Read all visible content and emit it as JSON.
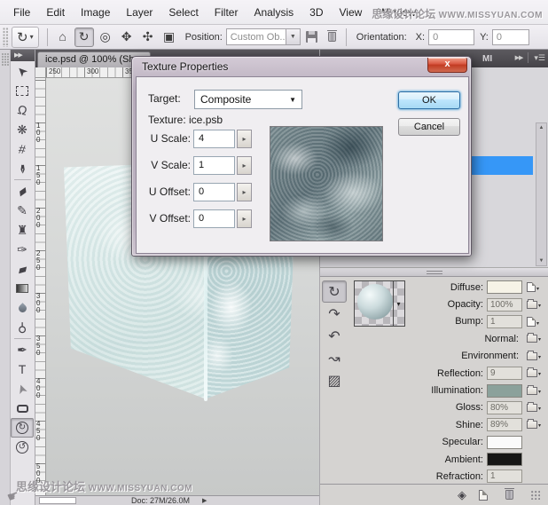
{
  "app": {
    "watermark_text": "思缘设计论坛",
    "watermark_url": "WWW.MISSYUAN.COM"
  },
  "menu_bar": {
    "items": [
      "File",
      "Edit",
      "Image",
      "Layer",
      "Select",
      "Filter",
      "Analysis",
      "3D",
      "View",
      "Window"
    ]
  },
  "options_bar": {
    "active_tool_glyph": "↻",
    "tools": [
      {
        "name": "return-to-initial-position",
        "glyph": "⌂"
      },
      {
        "name": "rotate-3d-object",
        "glyph": "↻",
        "selected": true
      },
      {
        "name": "roll-3d-object",
        "glyph": "◎"
      },
      {
        "name": "pan-3d-object",
        "glyph": "✥"
      },
      {
        "name": "slide-3d-object",
        "glyph": "✣"
      },
      {
        "name": "scale-3d-object",
        "glyph": "▣"
      }
    ],
    "position_label": "Position:",
    "position_value": "Custom Ob...",
    "orientation_label": "Orientation:",
    "x_label": "X:",
    "x_value": "0",
    "y_label": "Y:",
    "y_value": "0"
  },
  "toolbar": {
    "collapse_glyph": "▶▶",
    "separators_after": [
      5,
      13
    ],
    "tools": [
      {
        "name": "move-tool",
        "glyph": "➤",
        "rot": 225
      },
      {
        "name": "marquee-tool",
        "shape": "dashed-box"
      },
      {
        "name": "lasso-tool",
        "glyph": "Ω",
        "rot": 12
      },
      {
        "name": "quick-selection-tool",
        "glyph": "❋"
      },
      {
        "name": "crop-tool",
        "glyph": "#",
        "rot": 8
      },
      {
        "name": "eyedropper-tool",
        "glyph": "✒",
        "rot": 90
      },
      {
        "name": "healing-brush-tool",
        "glyph": "▰",
        "rot": -35
      },
      {
        "name": "brush-tool",
        "glyph": "✎"
      },
      {
        "name": "clone-stamp-tool",
        "glyph": "♜"
      },
      {
        "name": "history-brush-tool",
        "glyph": "✑"
      },
      {
        "name": "eraser-tool",
        "glyph": "▰",
        "rot": -15
      },
      {
        "name": "gradient-tool",
        "shape": "gradient-box"
      },
      {
        "name": "blur-tool",
        "shape": "droplet"
      },
      {
        "name": "dodge-tool",
        "glyph": "⚲",
        "rot": 180
      },
      {
        "name": "pen-tool",
        "glyph": "✒"
      },
      {
        "name": "type-tool",
        "glyph": "T"
      },
      {
        "name": "path-selection-tool",
        "glyph": "➤",
        "rot": 250,
        "hollow": true
      },
      {
        "name": "shape-tool",
        "shape": "rounded-rect"
      },
      {
        "name": "3d-rotate-tool",
        "glyph": "↻",
        "circled": true,
        "selected": true
      },
      {
        "name": "3d-camera-rotate-tool",
        "glyph": "↺",
        "circled": true
      }
    ]
  },
  "document": {
    "tab_title": "ice.psd @ 100% (Sh",
    "h_ruler_labels": [
      "250",
      "300",
      "350"
    ],
    "v_ruler_labels": [
      "100",
      "150",
      "200",
      "250",
      "300",
      "350",
      "400",
      "450",
      "500"
    ],
    "status_text": "Doc: 27M/26.0M"
  },
  "dialog": {
    "title": "Texture Properties",
    "close_glyph": "x",
    "target_label": "Target:",
    "target_value": "Composite",
    "texture_line": "Texture: ice.psb",
    "fields": [
      {
        "label": "U Scale:",
        "value": "4"
      },
      {
        "label": "V Scale:",
        "value": "1"
      },
      {
        "label": "U Offset:",
        "value": "0"
      },
      {
        "label": "V Offset:",
        "value": "0"
      }
    ],
    "ok_label": "OK",
    "cancel_label": "Cancel"
  },
  "right_dock": {
    "tab_label": "MI",
    "collapse_glyph": "▶▶",
    "materials_panel": {
      "tools": [
        {
          "name": "rotate-material",
          "glyph": "↻",
          "selected": true
        },
        {
          "name": "roll-material",
          "glyph": "↷"
        },
        {
          "name": "drag-material",
          "glyph": "↶"
        },
        {
          "name": "slide-material",
          "glyph": "↝"
        },
        {
          "name": "fill-material",
          "glyph": "▨"
        }
      ],
      "rows": [
        {
          "label": "Diffuse:",
          "swatch": "#f6f3e7",
          "icon": "texture"
        },
        {
          "label": "Opacity:",
          "value": "100%",
          "icon": "folder"
        },
        {
          "label": "Bump:",
          "value": "1",
          "icon": "texture"
        },
        {
          "label": "Normal:",
          "icon": "folder"
        },
        {
          "label": "Environment:",
          "icon": "folder"
        },
        {
          "label": "Reflection:",
          "value": "9",
          "icon": "folder"
        },
        {
          "label": "Illumination:",
          "swatch": "#8ba19b",
          "icon": "folder"
        },
        {
          "label": "Gloss:",
          "value": "80%",
          "icon": "folder"
        },
        {
          "label": "Shine:",
          "value": "89%",
          "icon": "folder"
        },
        {
          "label": "Specular:",
          "swatch": "#fafafa"
        },
        {
          "label": "Ambient:",
          "swatch": "#161616"
        },
        {
          "label": "Refraction:",
          "value": "1"
        }
      ]
    }
  },
  "colors": {
    "selection_blue": "#3697f7",
    "close_button_red": "#c13a22",
    "dialog_glass": "#b5aaba"
  }
}
